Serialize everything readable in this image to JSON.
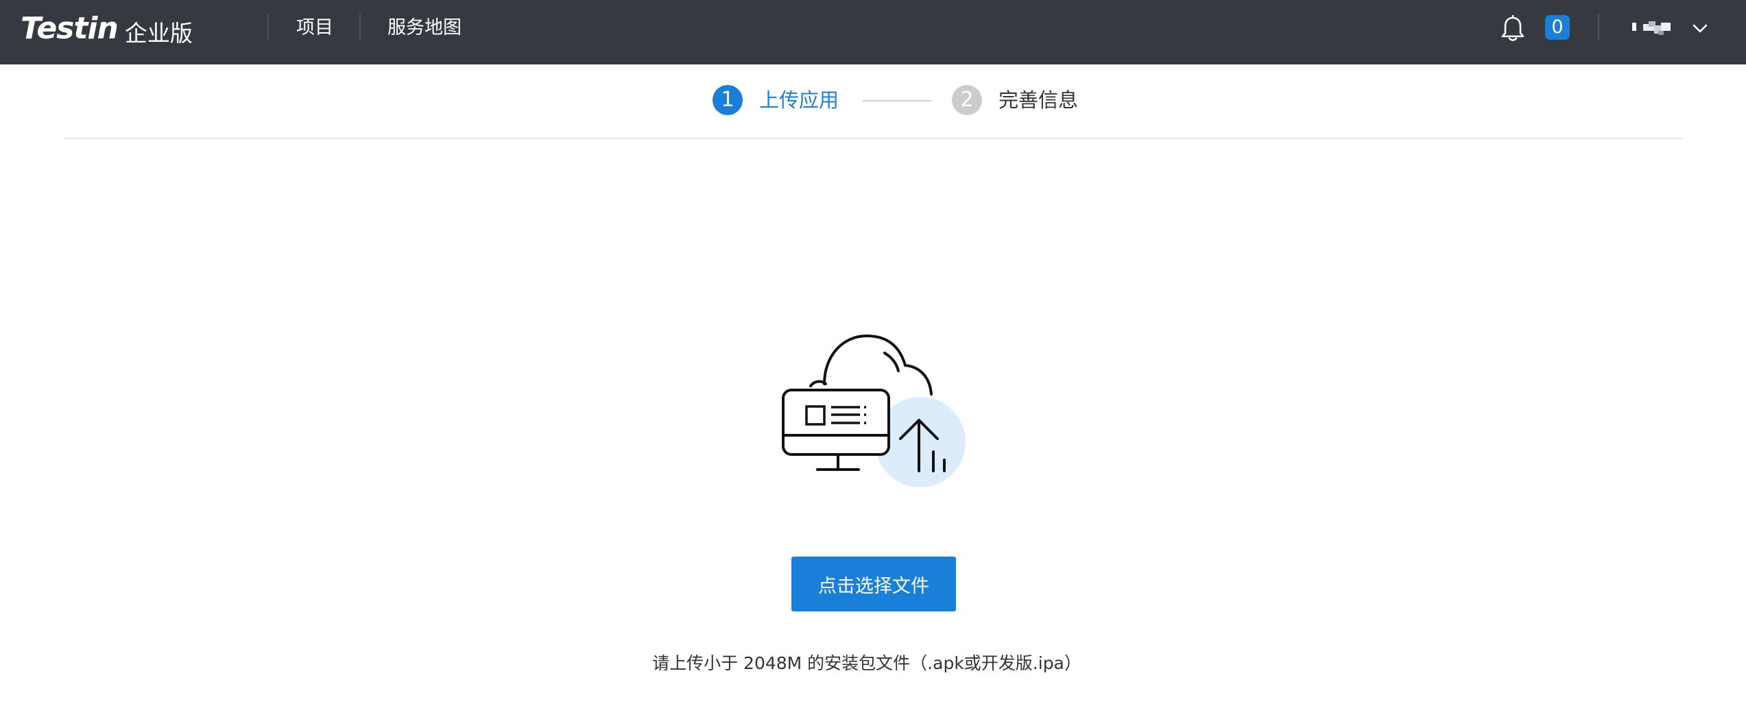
{
  "header": {
    "logo_text": "Testin",
    "logo_sub": "企业版",
    "nav": [
      {
        "label": "项目"
      },
      {
        "label": "服务地图"
      }
    ],
    "notification_icon": "bell-icon",
    "notification_count": "0",
    "user_menu_icon": "chevron-down-icon"
  },
  "steps": [
    {
      "number": "1",
      "label": "上传应用",
      "state": "active",
      "color": "#1a7fd9"
    },
    {
      "number": "2",
      "label": "完善信息",
      "state": "pending",
      "color": "#cccccc"
    }
  ],
  "upload": {
    "illustration_icon": "cloud-upload-computer-icon",
    "button_label": "点击选择文件",
    "hint": "请上传小于 2048M 的安装包文件（.apk或开发版.ipa）"
  },
  "colors": {
    "header_bg": "#363a40",
    "accent": "#1a7fd9",
    "illustration_circle": "#dcecfb"
  }
}
